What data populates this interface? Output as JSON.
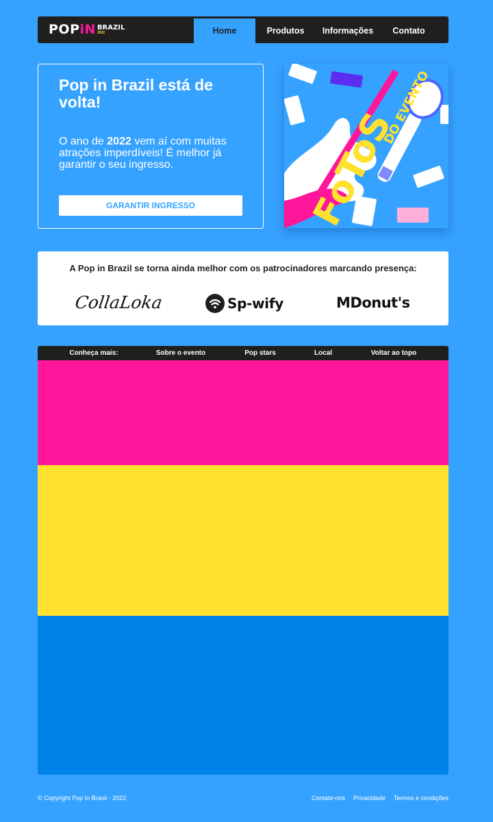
{
  "navbar": {
    "logo": {
      "pop": "POP",
      "in": "iN",
      "brazil": "BRAZIL",
      "year": "2022"
    },
    "items": [
      "Home",
      "Produtos",
      "Informações",
      "Contato"
    ]
  },
  "hero": {
    "title": "Pop in Brazil está de volta!",
    "text_before": "O ano de ",
    "text_year": "2022",
    "text_after": " vem aí com muitas atrações imperdíveis! É melhor já garantir o seu ingresso.",
    "cta_label": "GARANTIR INGRESSO"
  },
  "poster": {
    "word1": "FoToS",
    "word2": "DO EVENTO",
    "colors": {
      "bg": "#36a2ff",
      "pink": "#ff169b",
      "yellow": "#ffe12e",
      "purple": "#5a2df0",
      "white": "#ffffff"
    }
  },
  "sponsors": {
    "title": "A Pop in Brazil se torna ainda melhor com os patrocinadores marcando presença:",
    "logos": [
      "CollaLoka",
      "Sp-wify",
      "MDonut's"
    ]
  },
  "gallery": {
    "nav": [
      "Conheça mais:",
      "Sobre o evento",
      "Pop stars",
      "Local",
      "Voltar ao topo"
    ],
    "stripe_colors": [
      "#ff169b",
      "#ffe12e",
      "#0083e9"
    ]
  },
  "footer": {
    "copyright": "© Copyright Pop In Brasil - 2022",
    "links": [
      "Contate-nos",
      "Privacidade",
      "Termos e condições"
    ]
  },
  "colors": {
    "page_bg": "#36a2ff",
    "dark": "#1f1f1f",
    "accent_pink": "#ff169b",
    "accent_yellow": "#ffe12e"
  }
}
